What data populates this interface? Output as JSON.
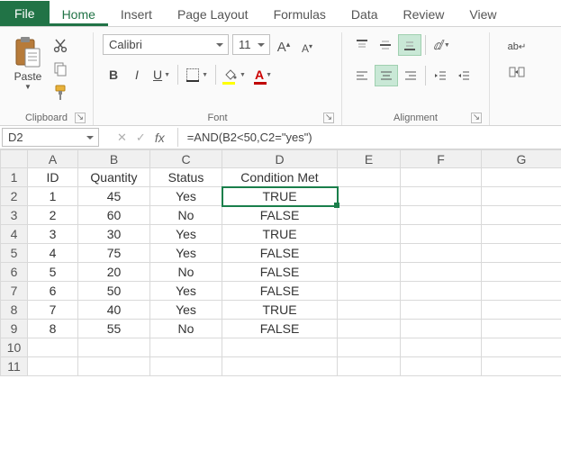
{
  "tabs": {
    "file": "File",
    "home": "Home",
    "insert": "Insert",
    "page_layout": "Page Layout",
    "formulas": "Formulas",
    "data": "Data",
    "review": "Review",
    "view": "View"
  },
  "ribbon": {
    "clipboard": {
      "paste": "Paste",
      "label": "Clipboard"
    },
    "font": {
      "name": "Calibri",
      "size": "11",
      "bold": "B",
      "italic": "I",
      "underline": "U",
      "label": "Font"
    },
    "alignment": {
      "label": "Alignment",
      "wrap_symbol": "ab"
    }
  },
  "namebox": "D2",
  "formula": "=AND(B2<50,C2=\"yes\")",
  "columns": [
    "A",
    "B",
    "C",
    "D",
    "E",
    "F",
    "G"
  ],
  "headers": {
    "A": "ID",
    "B": "Quantity",
    "C": "Status",
    "D": "Condition Met"
  },
  "rows": [
    {
      "A": "1",
      "B": "45",
      "C": "Yes",
      "D": "TRUE"
    },
    {
      "A": "2",
      "B": "60",
      "C": "No",
      "D": "FALSE"
    },
    {
      "A": "3",
      "B": "30",
      "C": "Yes",
      "D": "TRUE"
    },
    {
      "A": "4",
      "B": "75",
      "C": "Yes",
      "D": "FALSE"
    },
    {
      "A": "5",
      "B": "20",
      "C": "No",
      "D": "FALSE"
    },
    {
      "A": "6",
      "B": "50",
      "C": "Yes",
      "D": "FALSE"
    },
    {
      "A": "7",
      "B": "40",
      "C": "Yes",
      "D": "TRUE"
    },
    {
      "A": "8",
      "B": "55",
      "C": "No",
      "D": "FALSE"
    }
  ],
  "blank_rows": 2,
  "selected": "D2",
  "chart_data": {
    "type": "table",
    "title": "",
    "columns": [
      "ID",
      "Quantity",
      "Status",
      "Condition Met"
    ],
    "rows": [
      [
        1,
        45,
        "Yes",
        "TRUE"
      ],
      [
        2,
        60,
        "No",
        "FALSE"
      ],
      [
        3,
        30,
        "Yes",
        "TRUE"
      ],
      [
        4,
        75,
        "Yes",
        "FALSE"
      ],
      [
        5,
        20,
        "No",
        "FALSE"
      ],
      [
        6,
        50,
        "Yes",
        "FALSE"
      ],
      [
        7,
        40,
        "Yes",
        "TRUE"
      ],
      [
        8,
        55,
        "No",
        "FALSE"
      ]
    ]
  }
}
